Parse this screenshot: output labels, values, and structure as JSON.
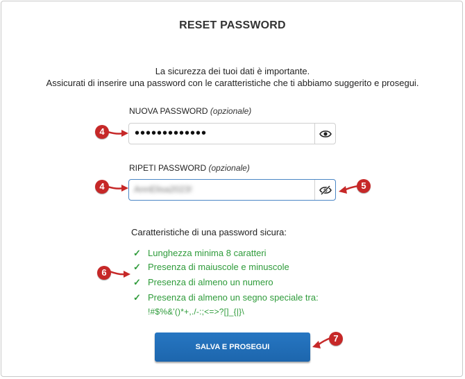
{
  "title": "RESET PASSWORD",
  "intro": {
    "line1": "La sicurezza dei tuoi dati è importante.",
    "line2": "Assicurati di inserire una password con le caratteristiche che ti abbiamo suggerito e prosegui."
  },
  "new_password": {
    "label": "NUOVA PASSWORD",
    "label_note": "(opzionale)",
    "value": "•••••••••••••"
  },
  "repeat_password": {
    "label": "RIPETI PASSWORD",
    "label_note": "(opzionale)",
    "value": "AnnElisa2023!"
  },
  "criteria": {
    "title": "Caratteristiche di una password sicura:",
    "items": [
      "Lunghezza minima 8 caratteri",
      "Presenza di maiuscole e minuscole",
      "Presenza di almeno un numero",
      "Presenza di almeno un segno speciale tra:"
    ],
    "special_chars": "!#$%&'()*+,./-:;<=>?[]_{|}\\"
  },
  "submit_label": "SALVA E PROSEGUI",
  "markers": {
    "new_password": "4",
    "repeat_password": "4",
    "toggle": "5",
    "criteria": "6",
    "submit": "7"
  },
  "colors": {
    "accent": "#1d6fb8",
    "success": "#2e9b3a",
    "marker": "#c62828"
  }
}
